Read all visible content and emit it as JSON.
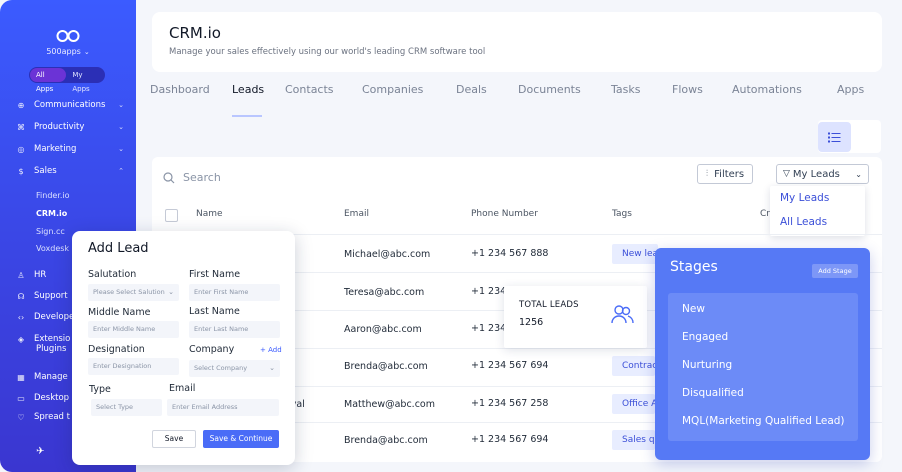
{
  "sidebar": {
    "brand": "500apps",
    "switch": {
      "all": "All Apps",
      "mine": "My Apps"
    },
    "nav": [
      {
        "label": "Communications",
        "icon": "communications-icon"
      },
      {
        "label": "Productivity",
        "icon": "productivity-icon"
      },
      {
        "label": "Marketing",
        "icon": "marketing-icon"
      },
      {
        "label": "Sales",
        "icon": "sales-icon"
      }
    ],
    "sales_sub": [
      "Finder.io",
      "CRM.io",
      "Sign.cc",
      "Voxdesk"
    ],
    "nav_lower": [
      {
        "label": "HR"
      },
      {
        "label": "Support"
      },
      {
        "label": "Develope"
      },
      {
        "label": "Extensio"
      },
      {
        "label": "Plugins"
      },
      {
        "label": "Manage"
      },
      {
        "label": "Desktop"
      },
      {
        "label": "Spread t"
      }
    ]
  },
  "header": {
    "title": "CRM.io",
    "subtitle": "Manage your sales effectively using our world's leading CRM software tool"
  },
  "tabs": [
    "Dashboard",
    "Leads",
    "Contacts",
    "Companies",
    "Deals",
    "Documents",
    "Tasks",
    "Flows",
    "Automations",
    "Apps"
  ],
  "toolbar": {
    "search_label": "Search",
    "filters_label": "Filters",
    "myleads_label": "My Leads",
    "dropdown": [
      "My Leads",
      "All Leads"
    ]
  },
  "table": {
    "columns": [
      "Name",
      "Email",
      "Phone Number",
      "Tags",
      "Cr"
    ],
    "rows": [
      {
        "name_tail": "tt",
        "email": "Michael@abc.com",
        "phone": "+1 234 567 888",
        "tag": "New lea"
      },
      {
        "name_tail": "",
        "email": "Teresa@abc.com",
        "phone": "+1 234",
        "tag": ""
      },
      {
        "name_tail": "",
        "email": "Aaron@abc.com",
        "phone": "+1 234",
        "tag": ""
      },
      {
        "name_tail": "",
        "email": "Brenda@abc.com",
        "phone": "+1 234 567 694",
        "tag": "Contract"
      },
      {
        "name_tail": "oval",
        "email": "Matthew@abc.com",
        "phone": "+1 234 567 258",
        "tag": "Office A"
      },
      {
        "name_tail": "",
        "email": "Brenda@abc.com",
        "phone": "+1 234 567 694",
        "tag": "Sales qu"
      }
    ]
  },
  "total_leads": {
    "label": "TOTAL LEADS",
    "value": "1256"
  },
  "stages": {
    "title": "Stages",
    "add_label": "Add Stage",
    "items": [
      "New",
      "Engaged",
      "Nurturing",
      "Disqualified",
      "MQL(Marketing Qualified Lead)"
    ]
  },
  "add_lead": {
    "title": "Add Lead",
    "salutation_label": "Salutation",
    "salutation_placeholder": "Please Select Salution",
    "first_name_label": "First Name",
    "first_name_placeholder": "Enter First Name",
    "middle_name_label": "Middle Name",
    "middle_name_placeholder": "Enter Middle Name",
    "last_name_label": "Last Name",
    "last_name_placeholder": "Enter Last Name",
    "designation_label": "Designation",
    "designation_placeholder": "Enter Designation",
    "company_label": "Company",
    "company_placeholder": "Select Company",
    "add_link": "+ Add",
    "type_label": "Type",
    "type_placeholder": "Select Type",
    "email_label": "Email",
    "email_placeholder": "Enter Email Address",
    "save_label": "Save",
    "save_continue_label": "Save & Continue"
  }
}
